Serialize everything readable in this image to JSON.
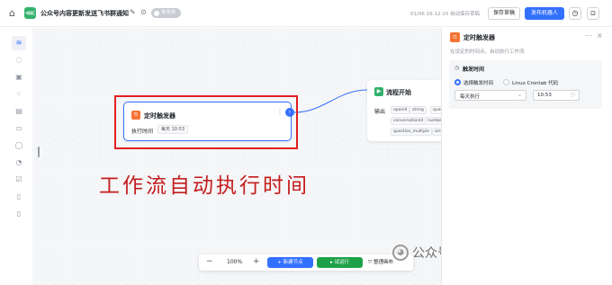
{
  "topbar": {
    "home_icon": "home-icon",
    "app_title": "公众号内容更新发送飞书群通知",
    "status_label": "未发布",
    "saved_text": "01/06 16:12:10 自动保存草稿",
    "save_label": "保存草稿",
    "publish_label": "发布机器人",
    "history_icon": "history-icon",
    "lock_icon": "lock-icon",
    "accent_color": "#3370ff"
  },
  "sidebar": {
    "items": [
      {
        "icon": "start-node-icon",
        "active": true
      },
      {
        "icon": "chat-icon",
        "active": false
      },
      {
        "icon": "llm-icon",
        "active": false
      },
      {
        "icon": "plugin-icon",
        "active": false
      },
      {
        "icon": "code-icon",
        "active": false
      },
      {
        "icon": "knowledge-icon",
        "active": false
      },
      {
        "icon": "condition-icon",
        "active": false
      },
      {
        "icon": "loop-icon",
        "active": false
      },
      {
        "icon": "database-icon",
        "active": false
      },
      {
        "icon": "variable-icon",
        "active": false
      },
      {
        "icon": "note-icon",
        "active": false
      }
    ]
  },
  "canvas": {
    "trigger_node": {
      "title": "定时触发器",
      "field_label": "执行时间",
      "field_value": "每天 10:53"
    },
    "start_node": {
      "title": "流程开始",
      "output_label": "输出",
      "chips": [
        "openid",
        "string",
        "ques",
        "conversationId",
        "numbe",
        "question_multiple",
        "arra"
      ]
    },
    "overlay_text": "工作流自动执行时间",
    "highlight_color": "#e02020"
  },
  "bottom_bar": {
    "zoom_out": "−",
    "zoom_value": "100%",
    "zoom_in": "+",
    "add_node_label": "+ 新建节点",
    "run_test_label": "▸ 试运行",
    "arrange_label": "整理画布"
  },
  "watermark": {
    "text": "公众号 · 芝麻私域流量"
  },
  "panel": {
    "title": "定时触发器",
    "description": "在设定的时间点，自动执行工作流",
    "section_title": "触发时间",
    "radio_options": [
      "选择触发时间",
      "Linux Crontab 代码"
    ],
    "selected_option": "选择触发时间",
    "frequency_value": "每天执行",
    "time_value": "10:53"
  }
}
